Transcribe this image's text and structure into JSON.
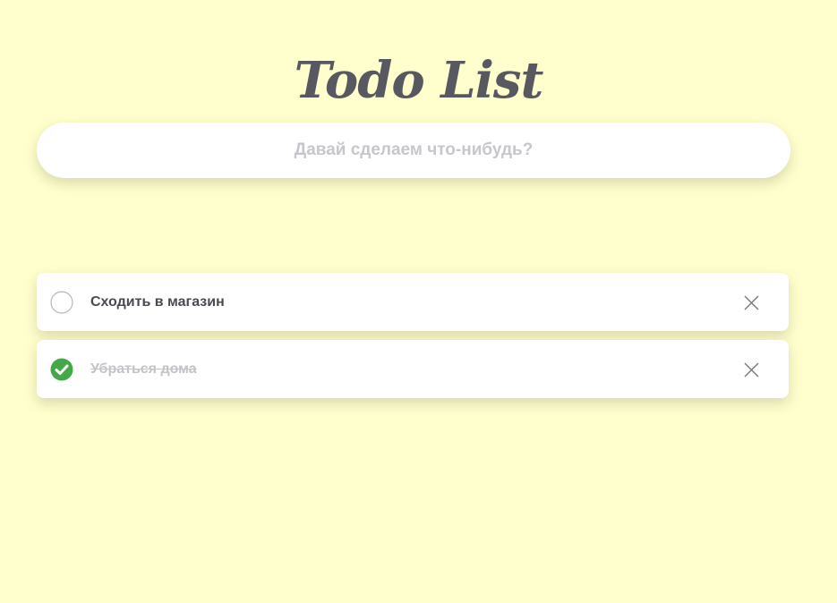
{
  "app": {
    "title": "Todo List"
  },
  "input": {
    "placeholder": "Давай сделаем что-нибудь?",
    "value": ""
  },
  "todos": [
    {
      "text": "Сходить в магазин",
      "done": false,
      "icon": "empty-circle-icon"
    },
    {
      "text": "Убраться дома",
      "done": true,
      "icon": "check-circle-icon"
    }
  ],
  "colors": {
    "background": "#ffffcd",
    "title": "#585860",
    "check_done": "#43a847",
    "check_empty_border": "#b8b8bc",
    "delete_icon": "#7a7a80"
  }
}
